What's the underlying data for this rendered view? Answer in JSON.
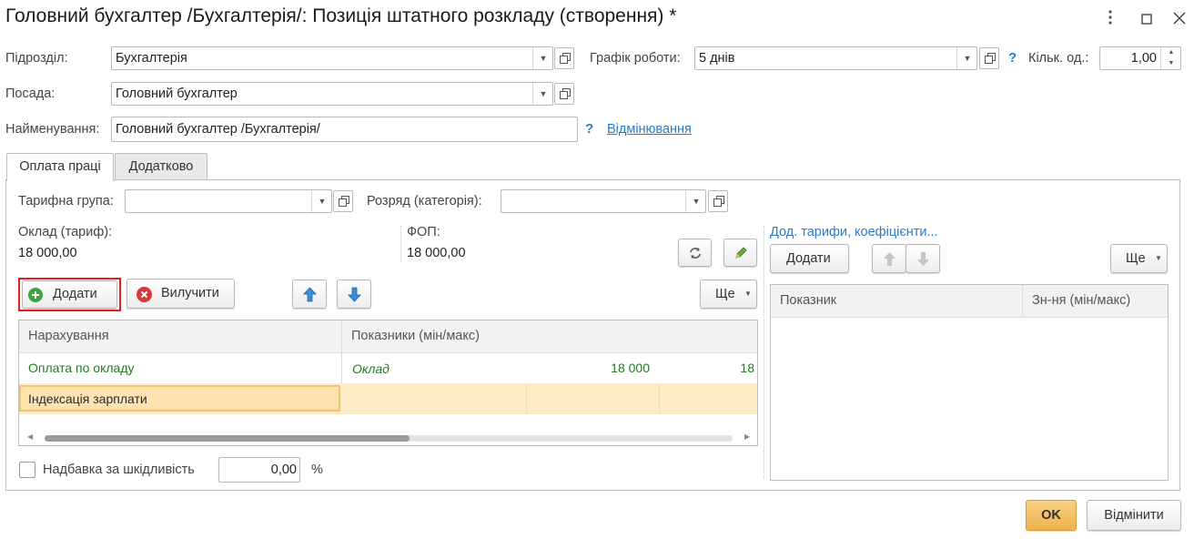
{
  "window": {
    "title": "Головний бухгалтер /Бухгалтерія/: Позиція штатного розкладу (створення) *",
    "more_icon": "more-vertical-icon",
    "maximize_icon": "maximize-icon",
    "close_icon": "close-icon"
  },
  "header": {
    "department_label": "Підрозділ:",
    "department_value": "Бухгалтерія",
    "schedule_label": "Графік роботи:",
    "schedule_value": "5 днів",
    "help_mark": "?",
    "units_label": "Кільк. од.:",
    "units_value": "1,00",
    "position_label": "Посада:",
    "position_value": "Головний бухгалтер",
    "name_label": "Найменування:",
    "name_value": "Головний бухгалтер /Бухгалтерія/",
    "declension_link": "Відмінювання"
  },
  "tabs": [
    {
      "label": "Оплата праці",
      "active": true
    },
    {
      "label": "Додатково",
      "active": false
    }
  ],
  "pay": {
    "tariff_group_label": "Тарифна група:",
    "tariff_group_value": "",
    "rank_label": "Розряд (категорія):",
    "rank_value": "",
    "salary_label": "Оклад (тариф):",
    "salary_value": "18 000,00",
    "fop_label": "ФОП:",
    "fop_value": "18 000,00",
    "toolbar": {
      "add_label": "Додати",
      "exclude_label": "Вилучити",
      "more_label": "Ще"
    },
    "grid": {
      "columns": [
        "Нарахування",
        "Показники (мін/макс)"
      ],
      "rows": [
        {
          "accrual": "Оплата по окладу",
          "indicator": "Оклад",
          "min": "18 000",
          "max": "18"
        },
        {
          "accrual": "Індексація зарплати",
          "indicator": "",
          "min": "",
          "max": "",
          "selected": true
        }
      ],
      "scroll_fraction": 0.53
    },
    "hazard_label": "Надбавка за шкідливість",
    "hazard_value": "0,00",
    "hazard_unit": "%"
  },
  "extra_rates": {
    "link": "Дод. тарифи, коефіцієнти...",
    "add_label": "Додати",
    "more_label": "Ще",
    "columns": [
      "Показник",
      "Зн-ня (мін/макс)"
    ]
  },
  "footer": {
    "ok_label": "OK",
    "cancel_label": "Відмінити"
  },
  "colors": {
    "accent_orange": "#f3c46e",
    "green_text": "#1e7b1e",
    "link_blue": "#2b7ac7",
    "selected_row": "#fdebc6",
    "highlight_red": "#e02020"
  }
}
